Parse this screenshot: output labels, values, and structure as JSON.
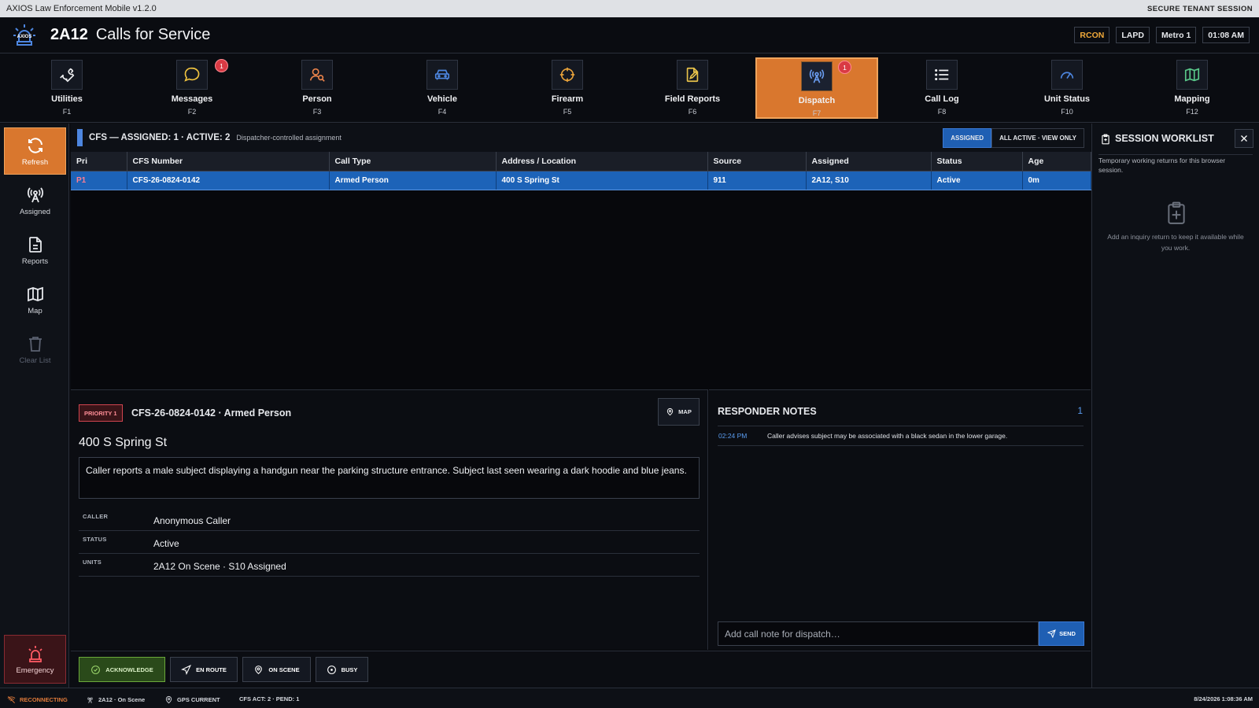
{
  "window": {
    "app_title": "AXIOS Law Enforcement Mobile v1.2.0",
    "session_label": "SECURE TENANT SESSION"
  },
  "header": {
    "logo_text": "AXIOS",
    "unit_id": "2A12",
    "title": "Calls for Service",
    "badges": [
      "RCON",
      "LAPD",
      "Metro 1",
      "01:08 AM"
    ]
  },
  "modules": [
    {
      "label": "Utilities",
      "key": "F1",
      "icon": "wrench-icon"
    },
    {
      "label": "Messages",
      "key": "F2",
      "icon": "message-bubble-icon",
      "badge": "1"
    },
    {
      "label": "Person",
      "key": "F3",
      "icon": "person-search-icon"
    },
    {
      "label": "Vehicle",
      "key": "F4",
      "icon": "car-icon"
    },
    {
      "label": "Firearm",
      "key": "F5",
      "icon": "crosshair-icon"
    },
    {
      "label": "Field Reports",
      "key": "F6",
      "icon": "report-edit-icon"
    },
    {
      "label": "Dispatch",
      "key": "F7",
      "icon": "radio-tower-icon",
      "badge": "1",
      "active": true
    },
    {
      "label": "Call Log",
      "key": "F8",
      "icon": "list-icon"
    },
    {
      "label": "Unit Status",
      "key": "F10",
      "icon": "gauge-icon"
    },
    {
      "label": "Mapping",
      "key": "F12",
      "icon": "map-icon"
    }
  ],
  "rail": {
    "refresh": "Refresh",
    "assigned": "Assigned",
    "reports": "Reports",
    "map": "Map",
    "clear": "Clear List",
    "emergency": "Emergency"
  },
  "cfs": {
    "title": "CFS — ASSIGNED: 1 · ACTIVE: 2",
    "subtitle": "Dispatcher-controlled assignment",
    "filter_assigned": "ASSIGNED",
    "filter_all": "ALL ACTIVE · VIEW ONLY",
    "columns": [
      "Pri",
      "CFS Number",
      "Call Type",
      "Address / Location",
      "Source",
      "Assigned",
      "Status",
      "Age"
    ],
    "rows": [
      {
        "pri": "P1",
        "number": "CFS-26-0824-0142",
        "type": "Armed Person",
        "address": "400 S Spring St",
        "source": "911",
        "assigned": "2A12, S10",
        "status": "Active",
        "age": "0m"
      }
    ]
  },
  "detail": {
    "priority": "PRIORITY 1",
    "title": "CFS-26-0824-0142 · Armed Person",
    "map_label": "MAP",
    "address": "400 S Spring St",
    "narrative": "Caller reports a male subject displaying a handgun near the parking structure entrance. Subject last seen wearing a dark hoodie and blue jeans.",
    "fields": [
      {
        "key": "CALLER",
        "value": "Anonymous Caller"
      },
      {
        "key": "STATUS",
        "value": "Active"
      },
      {
        "key": "UNITS",
        "value": "2A12 On Scene · S10 Assigned"
      }
    ]
  },
  "notes": {
    "title": "RESPONDER NOTES",
    "count": "1",
    "items": [
      {
        "time": "02:24 PM",
        "text": "Caller advises subject may be associated with a black sedan in the lower garage."
      }
    ],
    "input_placeholder": "Add call note for dispatch…",
    "send_label": "SEND"
  },
  "actions": {
    "acknowledge": "ACKNOWLEDGE",
    "en_route": "EN ROUTE",
    "on_scene": "ON SCENE",
    "busy": "BUSY"
  },
  "worklist": {
    "title": "SESSION WORKLIST",
    "subtitle": "Temporary working returns for this browser session.",
    "empty": "Add an inquiry return to keep it available while you work."
  },
  "status": {
    "connection": "RECONNECTING",
    "unit": "2A12 · On Scene",
    "gps": "GPS CURRENT",
    "cfs": "CFS ACT: 2 · PEND: 1",
    "datetime": "8/24/2026 1:08:36 AM"
  },
  "colors": {
    "accent_orange": "#d9772e",
    "select_blue": "#1d63b8",
    "alert_red": "#d93a44",
    "ack_green": "#6aa83a"
  }
}
